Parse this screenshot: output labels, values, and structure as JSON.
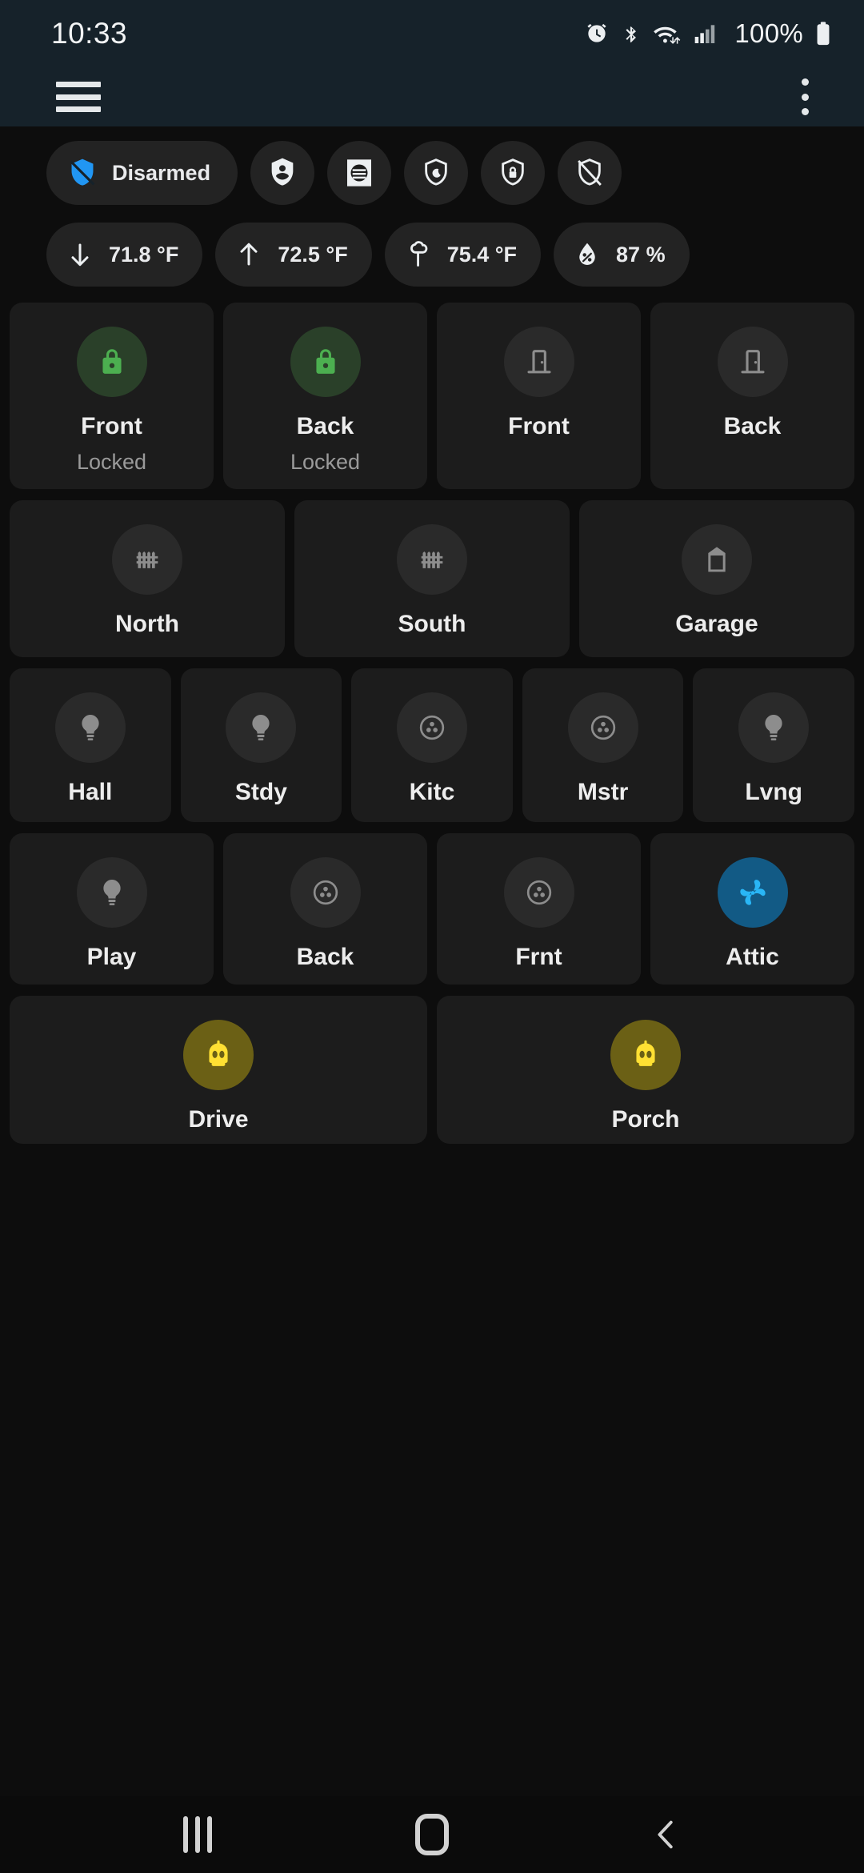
{
  "status_bar": {
    "time": "10:33",
    "battery_percent": "100%",
    "icons": [
      "alarm-clock-icon",
      "bluetooth-icon",
      "wifi-icon",
      "cellular-signal-icon",
      "battery-icon"
    ]
  },
  "toolbar": {
    "menu_icon": "hamburger-menu-icon",
    "overflow_icon": "more-vertical-icon"
  },
  "alarm_panel": {
    "current_state_label": "Disarmed",
    "current_state_icon": "shield-off-icon",
    "current_state_color": "#2196f3",
    "modes": [
      {
        "name": "arm-home",
        "icon": "shield-account-icon"
      },
      {
        "name": "arm-vacation",
        "icon": "shield-moon-filled-icon"
      },
      {
        "name": "arm-night",
        "icon": "shield-moon-icon"
      },
      {
        "name": "arm-away",
        "icon": "shield-lock-icon"
      },
      {
        "name": "disarm",
        "icon": "shield-off-outline-icon"
      }
    ]
  },
  "sensors": [
    {
      "icon": "arrow-down-icon",
      "value": "71.8 °F"
    },
    {
      "icon": "arrow-up-icon",
      "value": "72.5 °F"
    },
    {
      "icon": "tree-icon",
      "value": "75.4 °F"
    },
    {
      "icon": "water-percent-icon",
      "value": "87 %"
    }
  ],
  "rows": [
    {
      "name": "locks-and-doors-row",
      "height_class": "h-tall",
      "cards": [
        {
          "label": "Front",
          "state": "Locked",
          "icon": "lock-icon",
          "accent": "green",
          "active": true
        },
        {
          "label": "Back",
          "state": "Locked",
          "icon": "lock-icon",
          "accent": "green",
          "active": true
        },
        {
          "label": "Front",
          "state": "",
          "icon": "door-closed-icon",
          "accent": "",
          "active": false
        },
        {
          "label": "Back",
          "state": "",
          "icon": "door-closed-icon",
          "accent": "",
          "active": false
        }
      ]
    },
    {
      "name": "gates-and-garage-row",
      "height_class": "h-mid",
      "cards": [
        {
          "label": "North",
          "state": "",
          "icon": "gate-icon",
          "accent": "",
          "active": false
        },
        {
          "label": "South",
          "state": "",
          "icon": "gate-icon",
          "accent": "",
          "active": false
        },
        {
          "label": "Garage",
          "state": "",
          "icon": "garage-door-icon",
          "accent": "",
          "active": false
        }
      ]
    },
    {
      "name": "lights-row-1",
      "height_class": "h-std",
      "cards": [
        {
          "label": "Hall",
          "state": "",
          "icon": "lightbulb-icon",
          "accent": "",
          "active": false
        },
        {
          "label": "Stdy",
          "state": "",
          "icon": "lightbulb-icon",
          "accent": "",
          "active": false
        },
        {
          "label": "Kitc",
          "state": "",
          "icon": "ceiling-light-icon",
          "accent": "",
          "active": false
        },
        {
          "label": "Mstr",
          "state": "",
          "icon": "ceiling-light-icon",
          "accent": "",
          "active": false
        },
        {
          "label": "Lvng",
          "state": "",
          "icon": "lightbulb-icon",
          "accent": "",
          "active": false
        }
      ]
    },
    {
      "name": "lights-and-fan-row",
      "height_class": "h-short",
      "cards": [
        {
          "label": "Play",
          "state": "",
          "icon": "lightbulb-icon",
          "accent": "",
          "active": false
        },
        {
          "label": "Back",
          "state": "",
          "icon": "ceiling-light-icon",
          "accent": "",
          "active": false
        },
        {
          "label": "Frnt",
          "state": "",
          "icon": "ceiling-light-icon",
          "accent": "",
          "active": false
        },
        {
          "label": "Attic",
          "state": "",
          "icon": "fan-icon",
          "accent": "blue",
          "active": true
        }
      ]
    },
    {
      "name": "automations-row",
      "height_class": "h-robo",
      "cards": [
        {
          "label": "Drive",
          "state": "",
          "icon": "robot-icon",
          "accent": "amber",
          "active": true
        },
        {
          "label": "Porch",
          "state": "",
          "icon": "robot-icon",
          "accent": "amber",
          "active": true
        }
      ]
    }
  ],
  "nav_bar": {
    "recents_label": "recents-button",
    "home_label": "home-button",
    "back_label": "back-button"
  },
  "colors": {
    "page_background": "#0d0d0d",
    "toolbar_background": "#16222a",
    "card_background": "#1c1c1c",
    "chip_background": "#232323",
    "accent_blue": "#2196f3",
    "accent_green": "#4caf50",
    "accent_amber": "#ffe033",
    "accent_fan_blue": "#29b6f6"
  }
}
